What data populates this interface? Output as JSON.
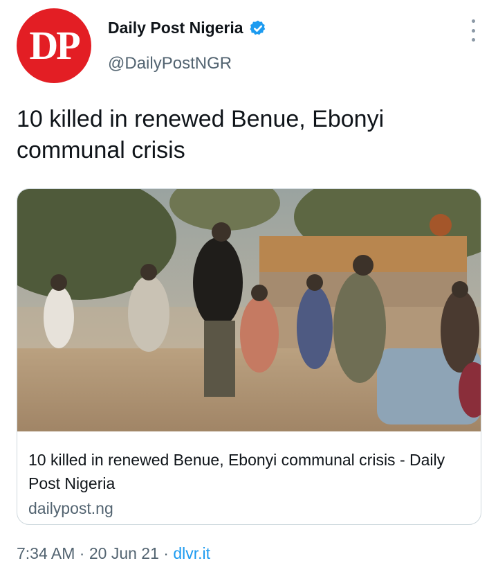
{
  "account": {
    "avatar_text": "DP",
    "display_name": "Daily Post Nigeria",
    "handle": "@DailyPostNGR",
    "brand_color": "#e31e24",
    "verified_color": "#1d9bf0"
  },
  "tweet": {
    "text": "10 killed in renewed Benue, Ebonyi communal crisis"
  },
  "card": {
    "title": "10 killed in renewed Benue, Ebonyi communal crisis - Daily Post Nigeria",
    "domain": "dailypost.ng",
    "image_icon": "photo-crowd-fleeing"
  },
  "meta": {
    "time": "7:34 AM",
    "separator1": " · ",
    "date": "20 Jun 21",
    "separator2": " · ",
    "source": "dlvr.it"
  }
}
